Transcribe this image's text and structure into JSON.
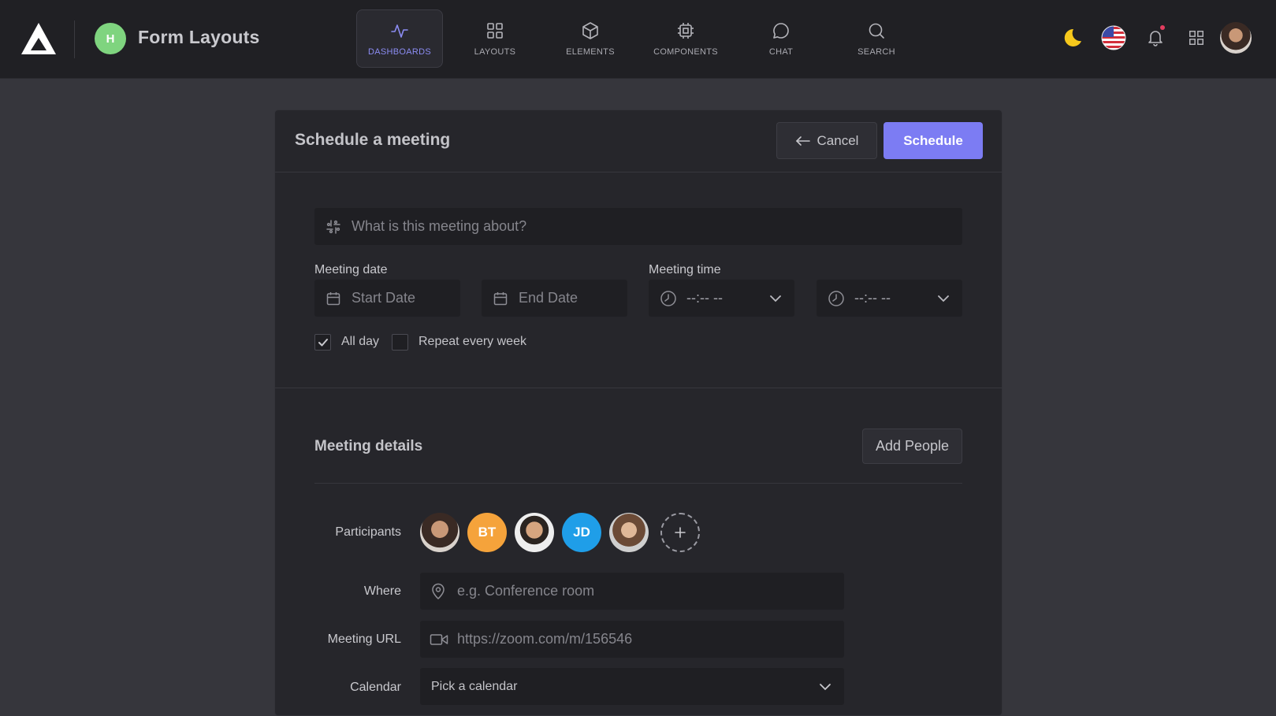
{
  "header": {
    "brand_initial": "H",
    "title": "Form Layouts",
    "nav": [
      {
        "label": "DASHBOARDS",
        "icon": "activity-icon",
        "active": true
      },
      {
        "label": "LAYOUTS",
        "icon": "grid-icon"
      },
      {
        "label": "ELEMENTS",
        "icon": "box-icon"
      },
      {
        "label": "COMPONENTS",
        "icon": "cpu-icon"
      },
      {
        "label": "CHAT",
        "icon": "chat-bubble-icon"
      },
      {
        "label": "SEARCH",
        "icon": "search-icon"
      }
    ],
    "right_icons": [
      "moon-icon",
      "us-flag-icon",
      "bell-icon",
      "apps-grid-icon",
      "user-avatar"
    ]
  },
  "form": {
    "title": "Schedule a meeting",
    "cancel_label": "Cancel",
    "schedule_label": "Schedule",
    "about_placeholder": "What is this meeting about?",
    "meeting_date_label": "Meeting date",
    "start_date_placeholder": "Start Date",
    "end_date_placeholder": "End Date",
    "meeting_time_label": "Meeting time",
    "time_start_value": "--:-- --",
    "time_end_value": "--:-- --",
    "all_day_label": "All day",
    "all_day_checked": true,
    "repeat_label": "Repeat every week",
    "repeat_checked": false
  },
  "details": {
    "title": "Meeting details",
    "add_people_label": "Add People",
    "participants_label": "Participants",
    "participants": [
      {
        "type": "photo"
      },
      {
        "type": "initials",
        "text": "BT",
        "color": "#f5a33b"
      },
      {
        "type": "photo"
      },
      {
        "type": "initials",
        "text": "JD",
        "color": "#1f9ee8"
      },
      {
        "type": "photo"
      }
    ],
    "where_label": "Where",
    "where_placeholder": "e.g. Conference room",
    "url_label": "Meeting URL",
    "url_placeholder": "https://zoom.com/m/156546",
    "calendar_label": "Calendar",
    "calendar_value": "Pick a calendar"
  },
  "colors": {
    "accent": "#7c7cf3",
    "background": "#36363c",
    "topbar": "#202024",
    "card": "#26262b"
  }
}
